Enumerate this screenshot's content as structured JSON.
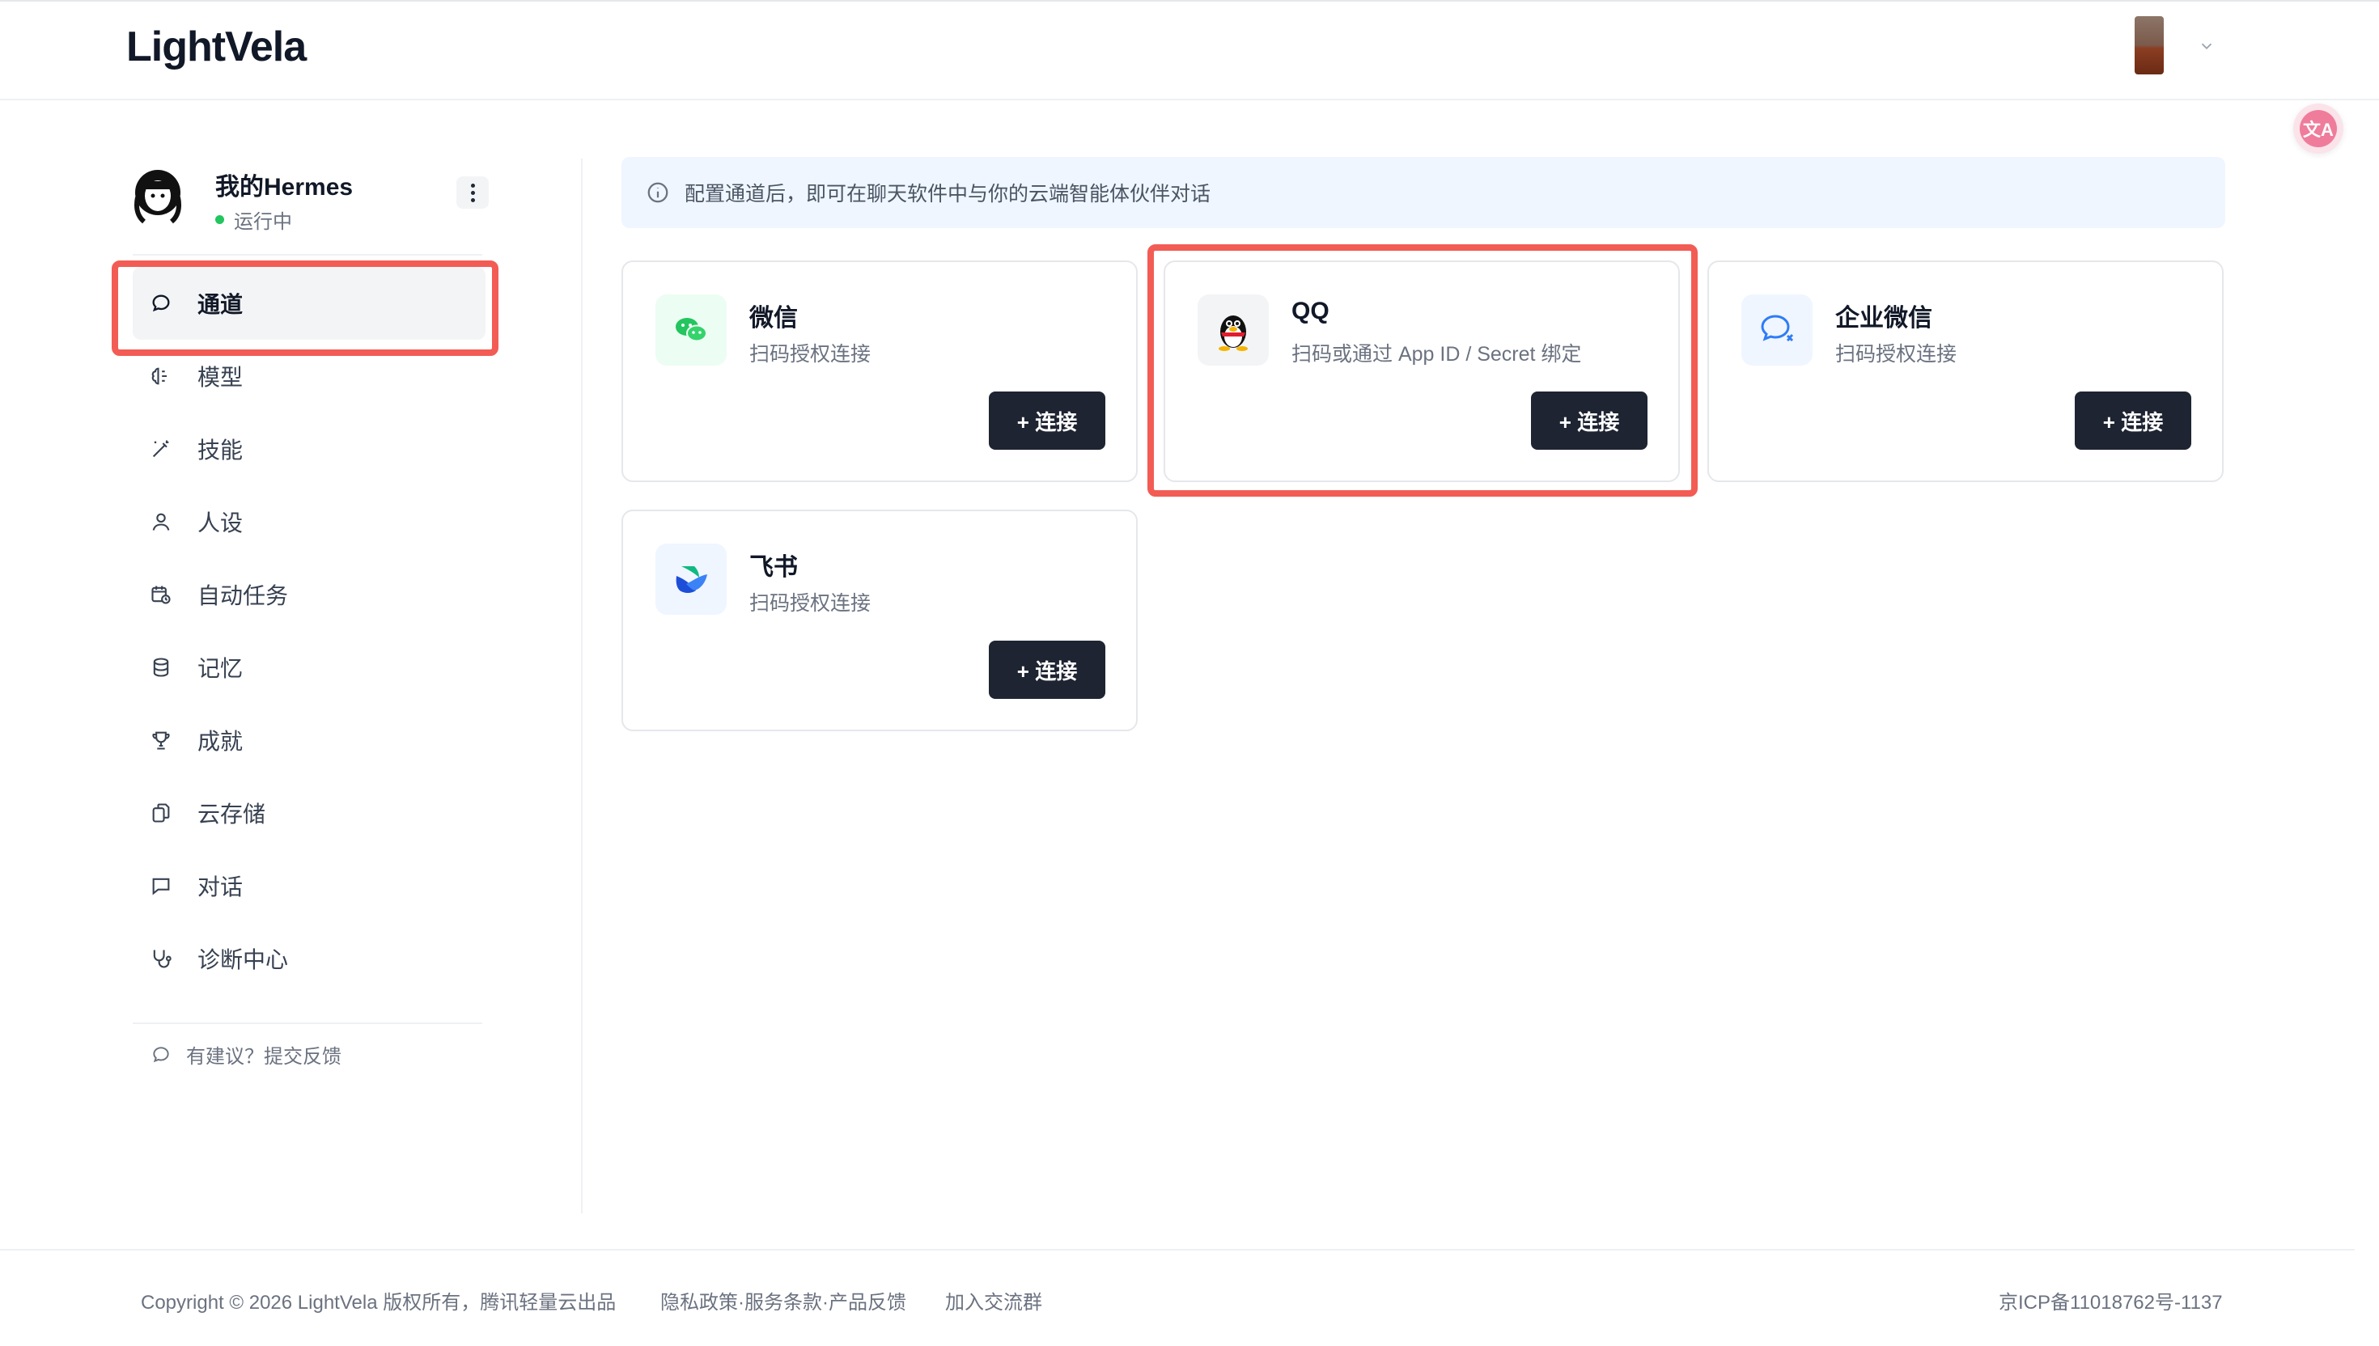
{
  "header": {
    "logo": "LightVela",
    "icons": {
      "user_avatar": "user-avatar-thumbnail",
      "chevron": "chevron-down-icon",
      "translate": "translate-icon"
    }
  },
  "sidebar": {
    "profile": {
      "name": "我的Hermes",
      "status": "运行中",
      "status_color": "#22c55e"
    },
    "items": [
      {
        "id": "channels",
        "label": "通道",
        "icon": "chat-bubble-icon",
        "active": true
      },
      {
        "id": "models",
        "label": "模型",
        "icon": "brain-icon",
        "active": false
      },
      {
        "id": "skills",
        "label": "技能",
        "icon": "magic-wand-icon",
        "active": false
      },
      {
        "id": "persona",
        "label": "人设",
        "icon": "user-icon",
        "active": false
      },
      {
        "id": "tasks",
        "label": "自动任务",
        "icon": "calendar-clock-icon",
        "active": false
      },
      {
        "id": "memory",
        "label": "记忆",
        "icon": "database-icon",
        "active": false
      },
      {
        "id": "achievements",
        "label": "成就",
        "icon": "trophy-icon",
        "active": false
      },
      {
        "id": "storage",
        "label": "云存储",
        "icon": "files-icon",
        "active": false
      },
      {
        "id": "chat",
        "label": "对话",
        "icon": "message-square-icon",
        "active": false
      },
      {
        "id": "diagnostics",
        "label": "诊断中心",
        "icon": "stethoscope-icon",
        "active": false
      }
    ],
    "feedback": "有建议？提交反馈"
  },
  "main": {
    "banner": "配置通道后，即可在聊天软件中与你的云端智能体伙伴对话",
    "channels": [
      {
        "name": "微信",
        "desc": "扫码授权连接",
        "button": "+ 连接",
        "icon": "wechat-icon",
        "icon_bg": "#ecfdf3"
      },
      {
        "name": "QQ",
        "desc": "扫码或通过 App ID / Secret 绑定",
        "button": "+ 连接",
        "icon": "qq-penguin-icon",
        "icon_bg": "#f3f4f6"
      },
      {
        "name": "企业微信",
        "desc": "扫码授权连接",
        "button": "+ 连接",
        "icon": "wecom-icon",
        "icon_bg": "#eff6ff"
      },
      {
        "name": "飞书",
        "desc": "扫码授权连接",
        "button": "+ 连接",
        "icon": "feishu-icon",
        "icon_bg": "#eff6ff"
      }
    ]
  },
  "footer": {
    "copyright": "Copyright © 2026 LightVela 版权所有，腾讯轻量云出品",
    "links": "隐私政策·服务条款·产品反馈",
    "join": "加入交流群",
    "icp": "京ICP备11018762号-1137"
  },
  "colors": {
    "accent_dark": "#1e2432",
    "highlight": "#f25c54",
    "banner_bg": "#eff6ff"
  }
}
